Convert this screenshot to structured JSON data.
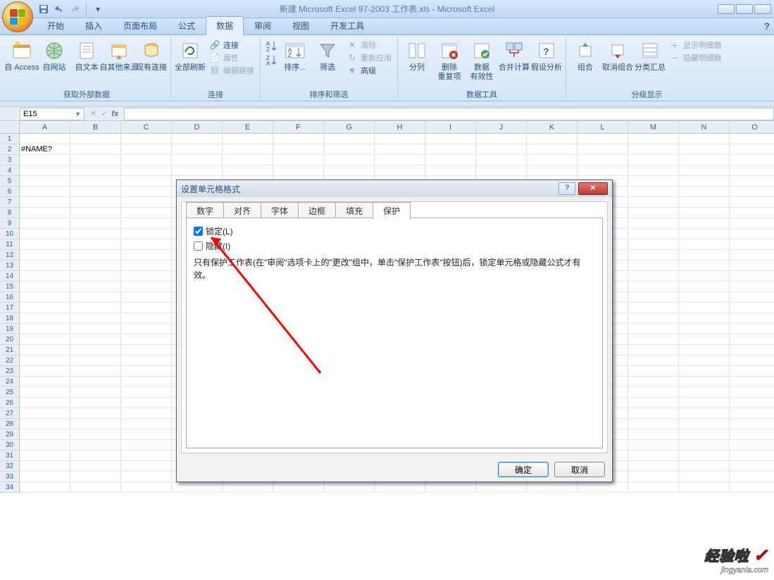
{
  "title": "新建 Microsoft Excel 97-2003 工作表.xls - Microsoft Excel",
  "tabs": [
    "开始",
    "插入",
    "页面布局",
    "公式",
    "数据",
    "审阅",
    "视图",
    "开发工具"
  ],
  "active_tab_index": 4,
  "ribbon": {
    "groups": [
      {
        "label": "获取外部数据",
        "big": [
          "自 Access",
          "自网站",
          "自文本",
          "自其他来源",
          "现有连接"
        ]
      },
      {
        "label": "连接",
        "big": [
          "全部刷新"
        ],
        "mini": [
          "连接",
          "属性",
          "编辑链接"
        ]
      },
      {
        "label": "排序和筛选",
        "big_pair": [
          "A↓Z",
          "Z↓A"
        ],
        "big": [
          "排序...",
          "筛选"
        ],
        "mini": [
          "清除",
          "重新应用",
          "高级"
        ]
      },
      {
        "label": "数据工具",
        "big": [
          "分列",
          "删除\n重复项",
          "数据\n有效性",
          "合并计算",
          "假设分析"
        ]
      },
      {
        "label": "分级显示",
        "big": [
          "组合",
          "取消组合",
          "分类汇总"
        ],
        "mini": [
          "显示明细数",
          "隐藏明细数"
        ]
      }
    ]
  },
  "namebox": "E15",
  "columns": [
    "A",
    "B",
    "C",
    "D",
    "E",
    "F",
    "G",
    "H",
    "I",
    "J",
    "K",
    "L",
    "M",
    "N",
    "O"
  ],
  "row_count": 34,
  "cell_value": "#NAME?",
  "cell_ref": {
    "row": 2,
    "col": "A"
  },
  "dialog": {
    "title": "设置单元格格式",
    "tabs": [
      "数字",
      "对齐",
      "字体",
      "边框",
      "填充",
      "保护"
    ],
    "active_tab_index": 5,
    "chk_lock": "锁定(L)",
    "chk_lock_checked": true,
    "chk_hide": "隐藏(I)",
    "chk_hide_checked": false,
    "note": "只有保护工作表(在\"审阅\"选项卡上的\"更改\"组中，单击\"保护工作表\"按钮)后，锁定单元格或隐藏公式才有效。",
    "ok": "确定",
    "cancel": "取消"
  },
  "watermark": {
    "line1": "经验啦",
    "line2": "jingyanla.com"
  }
}
